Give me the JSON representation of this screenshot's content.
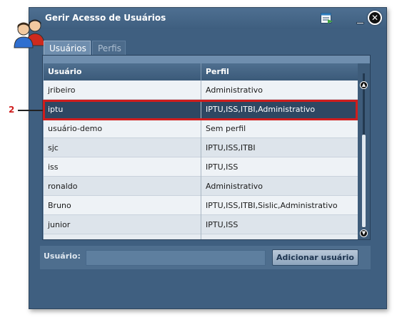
{
  "window": {
    "title": "Gerir Acesso de Usuários"
  },
  "tabs": [
    {
      "label": "Usuários",
      "active": true
    },
    {
      "label": "Perfis",
      "active": false
    }
  ],
  "table": {
    "columns": [
      "Usuário",
      "Perfil"
    ],
    "rows": [
      {
        "user": "jribeiro",
        "profile": "Administrativo"
      },
      {
        "user": "iptu",
        "profile": "IPTU,ISS,ITBI,Administrativo",
        "selected": true
      },
      {
        "user": "usuário-demo",
        "profile": "Sem perfil"
      },
      {
        "user": "sjc",
        "profile": "IPTU,ISS,ITBI"
      },
      {
        "user": "iss",
        "profile": "IPTU,ISS"
      },
      {
        "user": "ronaldo",
        "profile": "Administrativo"
      },
      {
        "user": "Bruno",
        "profile": "IPTU,ISS,ITBI,Sislic,Administrativo"
      },
      {
        "user": "junior",
        "profile": "IPTU,ISS"
      }
    ]
  },
  "callout": {
    "number": "2",
    "color": "#cf1d1d"
  },
  "footer": {
    "user_label": "Usuário:",
    "user_value": "",
    "add_button": "Adicionar usuário"
  },
  "icons": {
    "title": "users-icon",
    "toolbar": "table-export-icon",
    "minimize": "minimize-icon",
    "close": "close-icon",
    "scroll_up": "scroll-up-icon",
    "scroll_down": "scroll-down-icon"
  },
  "colors": {
    "window": "#3f5f80",
    "header": "#3b5a79",
    "selected_row": "#2e4762",
    "highlight": "#cf1d1d"
  }
}
